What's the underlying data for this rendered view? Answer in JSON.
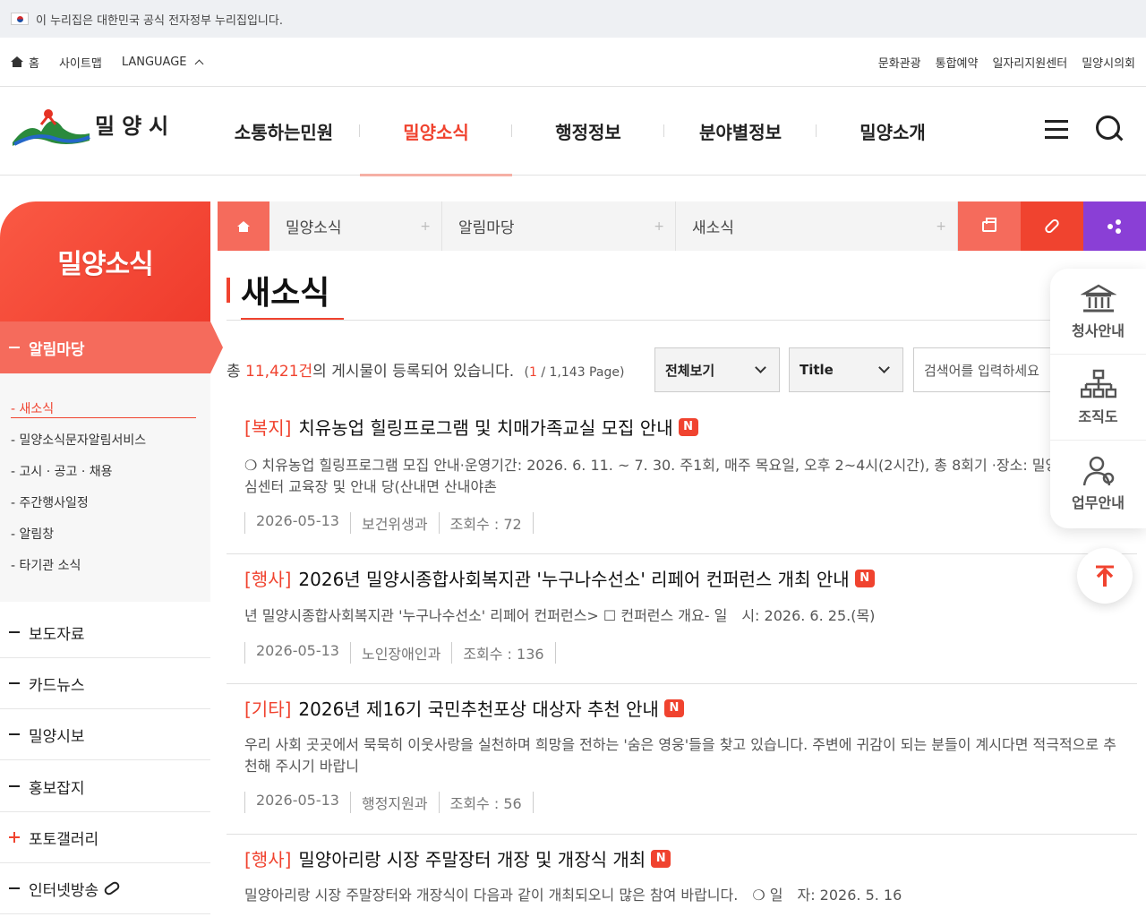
{
  "gov_banner": {
    "text": "이 누리집은 대한민국 공식 전자정부 누리집입니다."
  },
  "util": {
    "home": "홈",
    "sitemap": "사이트맵",
    "language": "LANGUAGE",
    "right_links": [
      "문화관광",
      "통합예약",
      "일자리지원센터",
      "밀양시의회"
    ]
  },
  "header": {
    "logo_text": "밀양시",
    "gnb": [
      "소통하는민원",
      "밀양소식",
      "행정정보",
      "분야별정보",
      "밀양소개"
    ],
    "active_index": 1
  },
  "sidebar": {
    "title": "밀양소식",
    "active_menu": "알림마당",
    "sub_items": [
      "- 새소식",
      "- 밀양소식문자알림서비스",
      "- 고시 · 공고 · 채용",
      "- 주간행사일정",
      "- 알림창",
      "- 타기관 소식"
    ],
    "menus": [
      "보도자료",
      "카드뉴스",
      "밀양시보",
      "홍보잡지",
      "포토갤러리",
      "인터넷방송"
    ]
  },
  "breadcrumb": {
    "items": [
      "밀양소식",
      "알림마당",
      "새소식"
    ]
  },
  "page": {
    "title": "새소식"
  },
  "board": {
    "count_prefix": "총",
    "count": "11,421건",
    "count_suffix": "의 게시물이 등록되어 있습니다.",
    "page_current": "1",
    "page_rest": " / 1,143 Page)",
    "page_open": "(",
    "filter_scope": "전체보기",
    "filter_field": "Title",
    "search_placeholder": "검색어를 입력하세요",
    "posts": [
      {
        "category": "[복지]",
        "title": "치유농업 힐링프로그램 및 치매가족교실 모집 안내",
        "badge": "N",
        "summary": "❍ 치유농업 힐링프로그램 모집 안내·운영기간: 2026. 6. 11. ~ 7. 30. 주1회, 매주 목요일, 오후 2~4시(2시간), 총 8회기 ·장소: 밀양시치매안심센터 교육장 및 안내 당(산내면 산내야촌",
        "date": "2026-05-13",
        "dept": "보건위생과",
        "views": "조회수 : 72"
      },
      {
        "category": "[행사]",
        "title": "2026년 밀양시종합사회복지관 '누구나수선소' 리페어 컨퍼런스 개최 안내",
        "badge": "N",
        "summary": "년 밀양시종합사회복지관 '누구나수선소' 리페어 컨퍼런스> ☐ 컨퍼런스 개요- 일　시: 2026. 6. 25.(목)",
        "date": "2026-05-13",
        "dept": "노인장애인과",
        "views": "조회수 : 136"
      },
      {
        "category": "[기타]",
        "title": "2026년 제16기 국민추천포상 대상자 추천 안내",
        "badge": "N",
        "summary": "우리 사회 곳곳에서 묵묵히 이웃사랑을 실천하며 희망을 전하는 '숨은 영웅'들을 찾고 있습니다. 주변에 귀감이 되는 분들이 계시다면 적극적으로 추천해 주시기 바랍니",
        "date": "2026-05-13",
        "dept": "행정지원과",
        "views": "조회수 : 56"
      },
      {
        "category": "[행사]",
        "title": "밀양아리랑 시장 주말장터 개장 및 개장식 개최",
        "badge": "N",
        "summary": " 밀양아리랑 시장 주말장터와 개장식이 다음과 같이 개최되오니 많은 참여 바랍니다.　❍ 일　자: 2026. 5. 16"
      }
    ]
  },
  "quick_menu": [
    "청사안내",
    "조직도",
    "업무안내"
  ]
}
